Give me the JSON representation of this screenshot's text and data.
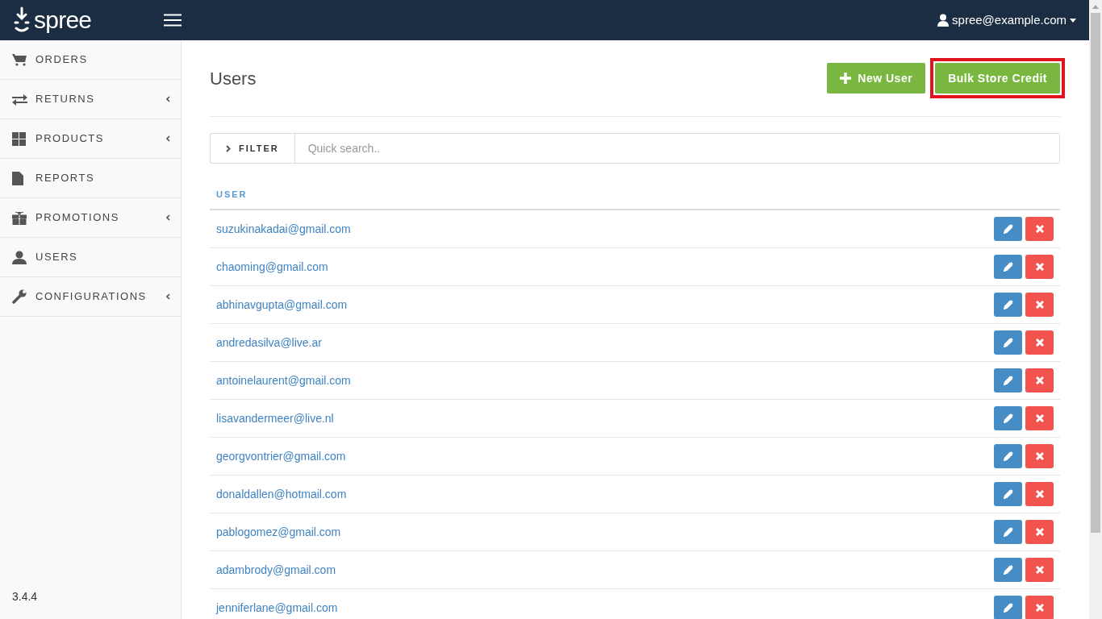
{
  "header": {
    "logo": "spree",
    "user": "spree@example.com"
  },
  "sidebar": {
    "items": [
      {
        "label": "ORDERS",
        "has_submenu": false
      },
      {
        "label": "RETURNS",
        "has_submenu": true
      },
      {
        "label": "PRODUCTS",
        "has_submenu": true
      },
      {
        "label": "REPORTS",
        "has_submenu": false
      },
      {
        "label": "PROMOTIONS",
        "has_submenu": true
      },
      {
        "label": "USERS",
        "has_submenu": false
      },
      {
        "label": "CONFIGURATIONS",
        "has_submenu": true
      }
    ],
    "version": "3.4.4"
  },
  "page": {
    "title": "Users",
    "buttons": [
      {
        "label": "New User",
        "highlighted": false
      },
      {
        "label": "Bulk Store Credit",
        "highlighted": true
      }
    ]
  },
  "filter": {
    "label": "FILTER",
    "placeholder": "Quick search.."
  },
  "table": {
    "columns": [
      "USER"
    ],
    "rows": [
      "suzukinakadai@gmail.com",
      "chaoming@gmail.com",
      "abhinavgupta@gmail.com",
      "andredasilva@live.ar",
      "antoinelaurent@gmail.com",
      "lisavandermeer@live.nl",
      "georgvontrier@gmail.com",
      "donaldallen@hotmail.com",
      "pablogomez@gmail.com",
      "adambrody@gmail.com",
      "jenniferlane@gmail.com"
    ]
  }
}
